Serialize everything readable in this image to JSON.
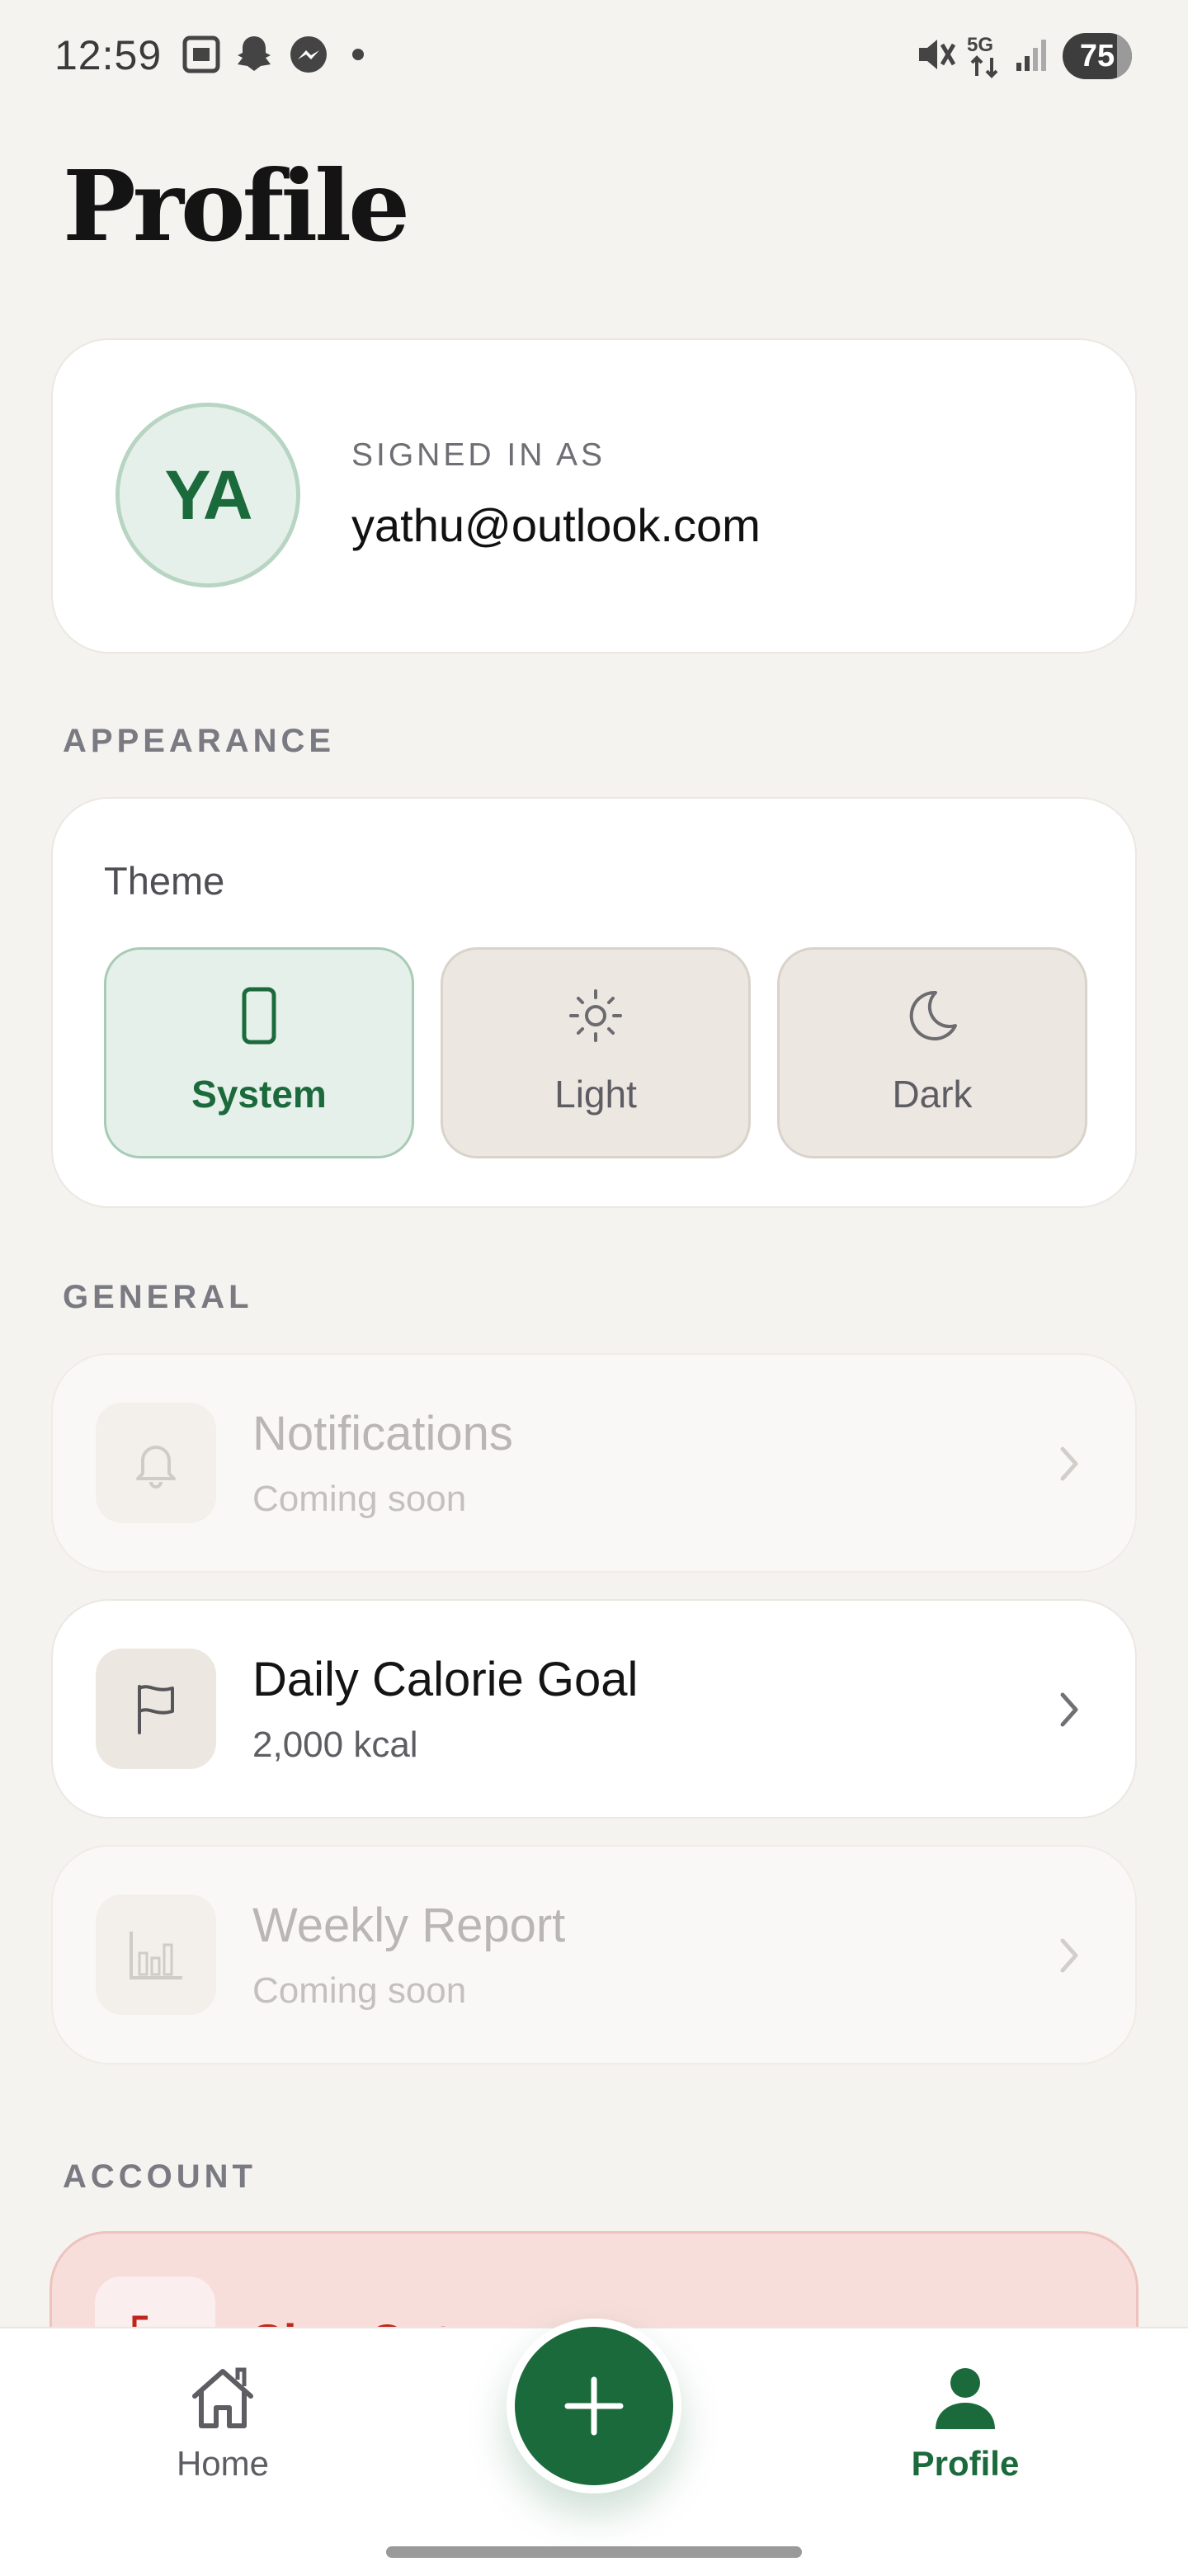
{
  "status_bar": {
    "time": "12:59",
    "battery": "75",
    "icons": [
      "screenshot-icon",
      "snapchat-icon",
      "messenger-icon",
      "dot-icon",
      "mute-icon",
      "5g-icon",
      "signal-icon"
    ]
  },
  "page": {
    "title": "Profile"
  },
  "account": {
    "initials": "YA",
    "signed_in_label": "SIGNED IN AS",
    "email": "yathu@outlook.com"
  },
  "appearance": {
    "section_label": "APPEARANCE",
    "theme_label": "Theme",
    "options": [
      {
        "label": "System",
        "icon": "phone-icon",
        "selected": true
      },
      {
        "label": "Light",
        "icon": "sun-icon",
        "selected": false
      },
      {
        "label": "Dark",
        "icon": "moon-icon",
        "selected": false
      }
    ]
  },
  "general": {
    "section_label": "GENERAL",
    "items": [
      {
        "title": "Notifications",
        "subtitle": "Coming soon",
        "icon": "bell-icon",
        "enabled": false
      },
      {
        "title": "Daily Calorie Goal",
        "subtitle": "2,000 kcal",
        "icon": "flag-icon",
        "enabled": true
      },
      {
        "title": "Weekly Report",
        "subtitle": "Coming soon",
        "icon": "bar-chart-icon",
        "enabled": false
      }
    ]
  },
  "account_section": {
    "section_label": "ACCOUNT",
    "sign_out_label": "Sign Out"
  },
  "nav": {
    "home": "Home",
    "profile": "Profile",
    "active": "Profile"
  },
  "colors": {
    "accent": "#1b6a3b",
    "background": "#f5f3ef",
    "danger": "#c0261c"
  }
}
